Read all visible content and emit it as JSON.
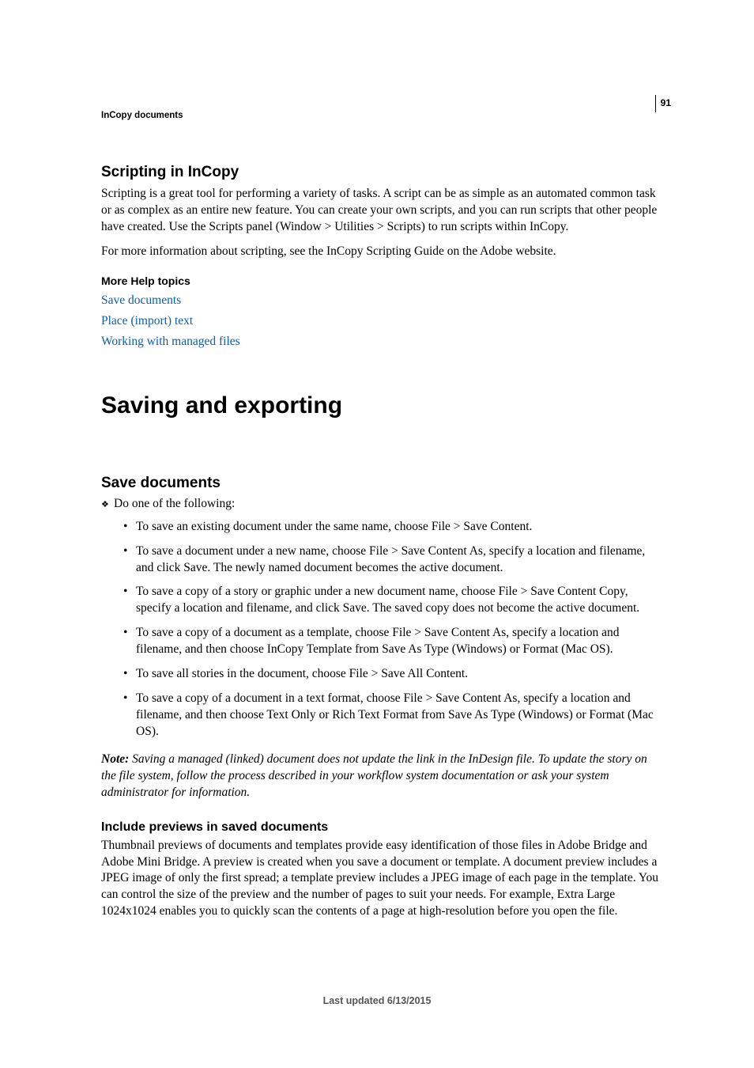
{
  "page_number": "91",
  "running_head": "InCopy documents",
  "section1": {
    "title": "Scripting in InCopy",
    "para1": "Scripting is a great tool for performing a variety of tasks. A script can be as simple as an automated common task or as complex as an entire new feature. You can create your own scripts, and you can run scripts that other people have created. Use the Scripts panel (Window > Utilities > Scripts) to run scripts within InCopy.",
    "para2": "For more information about scripting, see the InCopy Scripting Guide on the Adobe website."
  },
  "help": {
    "heading": "More Help topics",
    "links": [
      "Save documents",
      "Place (import) text",
      "Working with managed files"
    ]
  },
  "chapter_title": "Saving and exporting",
  "section2": {
    "title": "Save documents",
    "lead": "Do one of the following:",
    "items": [
      "To save an existing document under the same name, choose File > Save Content.",
      "To save a document under a new name, choose File > Save Content As, specify a location and filename, and click Save. The newly named document becomes the active document.",
      "To save a copy of a story or graphic under a new document name, choose File > Save Content Copy, specify a location and filename, and click Save. The saved copy does not become the active document.",
      "To save a copy of a document as a template, choose File > Save Content As, specify a location and filename, and then choose InCopy Template from Save As Type (Windows) or Format (Mac OS).",
      "To save all stories in the document, choose File > Save All Content.",
      "To save a copy of a document in a text format, choose File > Save Content As, specify a location and filename, and then choose Text Only or Rich Text Format from Save As Type (Windows) or Format (Mac OS)."
    ],
    "note_label": "Note: ",
    "note_text": "Saving a managed (linked) document does not update the link in the InDesign file. To update the story on the file system, follow the process described in your workflow system documentation or ask your system administrator for information."
  },
  "section3": {
    "title": "Include previews in saved documents",
    "para": "Thumbnail previews of documents and templates provide easy identification of those files in Adobe Bridge and Adobe Mini Bridge. A preview is created when you save a document or template. A document preview includes a JPEG image of only the first spread; a template preview includes a JPEG image of each page in the template. You can control the size of the preview and the number of pages to suit your needs. For example, Extra Large 1024x1024 enables you to quickly scan the contents of a page at high-resolution before you open the file."
  },
  "footer": "Last updated 6/13/2015"
}
